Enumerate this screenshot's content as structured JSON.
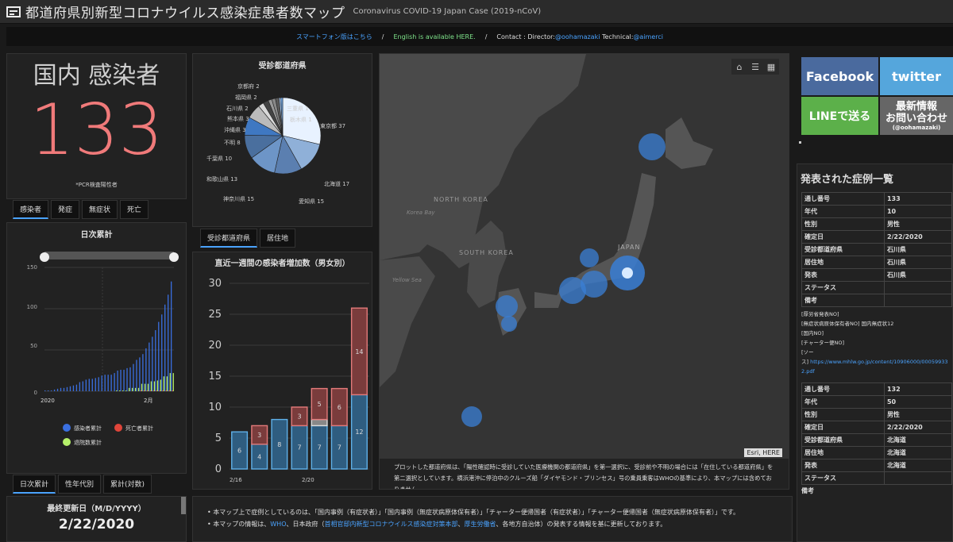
{
  "header": {
    "title": "都道府県別新型コロナウイルス感染症患者数マップ",
    "subtitle": "Coronavirus COVID-19 Japan Case (2019-nCoV)"
  },
  "infobar": {
    "smartphone": "スマートフォン版はこちら",
    "sep1": "/",
    "english": "English is available HERE.",
    "sep2": "/",
    "contact_prefix": "Contact : Director:",
    "director": "@oohamazaki",
    "technical_prefix": " Technical:",
    "technical": "@aimerci"
  },
  "summary": {
    "label": "国内 感染者",
    "count": "133",
    "footnote": "*PCR検査陽性者",
    "tabs": [
      "感染者",
      "発症",
      "無症状",
      "死亡"
    ]
  },
  "daily": {
    "title": "日次累計",
    "y_ticks": [
      "150",
      "100",
      "50",
      "0"
    ],
    "x_ticks": [
      "2020",
      "2月"
    ],
    "legend": [
      {
        "label": "感染者累計",
        "color": "#3a6fe0"
      },
      {
        "label": "死亡者累計",
        "color": "#e0453a"
      },
      {
        "label": "退院数累計",
        "color": "#b5f06a"
      }
    ],
    "tabs": [
      "日次累計",
      "性年代別",
      "累計(対数)"
    ]
  },
  "pie": {
    "title": "受診都道府県",
    "tabs": [
      "受診都道府県",
      "居住地"
    ]
  },
  "weekly": {
    "title": "直近一週間の感染者増加数（男女別）",
    "y_ticks": [
      "30",
      "25",
      "20",
      "15",
      "10",
      "5",
      "0"
    ],
    "x_ticks": [
      "2/16",
      "2/20"
    ]
  },
  "map": {
    "labels": {
      "north_korea": "NORTH KOREA",
      "south_korea": "SOUTH KOREA",
      "korea_bay": "Korea Bay",
      "yellow_sea": "Yellow Sea",
      "japan": "JAPAN"
    },
    "attribution": "Esri, HERE",
    "caption": "プロットした都道府県は、「陽性確認時に受診していた医療機関の都道府県」を第一選択に、受診前や不明の場合には「在住している都道府県」を第二選択としています。横浜港沖に停泊中のクルーズ船「ダイヤモンド・プリンセス」号の乗員乗客はWHOの基準により、本マップには含めておりません。"
  },
  "social": {
    "facebook": "Facebook",
    "twitter": "twitter",
    "line": "LINEで送る",
    "news_line1": "最新情報",
    "news_line2": "お問い合わせ",
    "news_handle": "(@oohamazaki)"
  },
  "cases": {
    "title": "発表された症例一覧",
    "case1": [
      [
        "通し番号",
        "133"
      ],
      [
        "年代",
        "10"
      ],
      [
        "性別",
        "男性"
      ],
      [
        "確定日",
        "2/22/2020"
      ],
      [
        "受診都道府県",
        "石川県"
      ],
      [
        "居住地",
        "石川県"
      ],
      [
        "発表",
        "石川県"
      ],
      [
        "ステータス",
        ""
      ],
      [
        "備考",
        ""
      ]
    ],
    "case1_notes": [
      "[厚労省発表NO]",
      "[無症状病原体保有者NO] 国内無症状12",
      "[国内NO]",
      "[チャーター便NO]",
      "[ソー"
    ],
    "case1_source_prefix": "ス]",
    "case1_source_url": "https://www.mhlw.go.jp/content/10906000/00059933",
    "case1_source_url2": "2.pdf",
    "case2": [
      [
        "通し番号",
        "132"
      ],
      [
        "年代",
        "50"
      ],
      [
        "性別",
        "男性"
      ],
      [
        "確定日",
        "2/22/2020"
      ],
      [
        "受診都道府県",
        "北海道"
      ],
      [
        "居住地",
        "北海道"
      ],
      [
        "発表",
        "北海道"
      ],
      [
        "ステータス",
        ""
      ]
    ],
    "case2_more": "備考"
  },
  "updated": {
    "label": "最終更新日（M/D/YYYY）",
    "date": "2/22/2020"
  },
  "footer_notes": {
    "line1": "本マップ上で症例としているのは、「国内事例（有症状者）」「国内事例（無症状病原体保有者）」「チャーター便帰国者（有症状者）」「チャーター便帰国者（無症状病原体保有者）」です。",
    "line2_a": "本マップの情報は、",
    "line2_who": "WHO",
    "line2_b": "、日本政府（",
    "line2_gov": "首相官邸内新型コロナウイルス感染症対策本部",
    "line2_c": "、",
    "line2_mhlw": "厚生労働省",
    "line2_d": "、各地方自治体）の発表する情報を基に更新しております。"
  },
  "chart_data": [
    {
      "type": "bar",
      "title": "日次累計",
      "ylim": [
        0,
        150
      ],
      "series": [
        {
          "name": "感染者累計",
          "values": [
            1,
            1,
            1,
            2,
            3,
            4,
            4,
            5,
            6,
            7,
            8,
            11,
            12,
            14,
            15,
            15,
            16,
            17,
            19,
            20,
            20,
            20,
            22,
            25,
            26,
            26,
            28,
            29,
            33,
            38,
            41,
            45,
            52,
            59,
            66,
            74,
            84,
            93,
            105,
            117,
            133
          ]
        },
        {
          "name": "死亡者累計",
          "values": [
            0,
            0,
            0,
            0,
            0,
            0,
            0,
            0,
            0,
            0,
            0,
            0,
            0,
            0,
            0,
            0,
            0,
            0,
            0,
            0,
            0,
            0,
            0,
            0,
            0,
            0,
            0,
            0,
            0,
            0,
            1,
            1,
            1,
            1,
            1,
            1,
            1,
            1,
            1,
            1,
            1
          ]
        },
        {
          "name": "退院数累計",
          "values": [
            0,
            0,
            0,
            0,
            0,
            0,
            0,
            0,
            0,
            0,
            0,
            0,
            0,
            0,
            0,
            0,
            0,
            0,
            0,
            0,
            0,
            0,
            1,
            1,
            1,
            1,
            4,
            4,
            4,
            4,
            9,
            9,
            9,
            12,
            12,
            13,
            14,
            18,
            18,
            22,
            22
          ]
        }
      ]
    },
    {
      "type": "pie",
      "title": "受診都道府県",
      "categories": [
        "東京都",
        "北海道",
        "愛知県",
        "神奈川県",
        "和歌山県",
        "千葉県",
        "不明",
        "沖縄県",
        "熊本県",
        "石川県",
        "福岡県",
        "京都府",
        "三重県",
        "栃木県"
      ],
      "values": [
        37,
        17,
        15,
        15,
        13,
        10,
        8,
        3,
        3,
        2,
        2,
        2,
        1,
        1
      ],
      "labels": [
        "東京都 37",
        "北海道 17",
        "愛知県 15",
        "神奈川県 15",
        "和歌山県 13",
        "千葉県 10",
        "不明 8",
        "沖縄県 3",
        "熊本県 3",
        "石川県 2",
        "福岡県 2",
        "京都府 2",
        "三重県 1",
        "栃木県 1"
      ]
    },
    {
      "type": "bar",
      "title": "直近一週間の感染者増加数（男女別）",
      "ylim": [
        0,
        30
      ],
      "categories": [
        "2/16",
        "2/17",
        "2/18",
        "2/19",
        "2/20",
        "2/21",
        "2/22"
      ],
      "series": [
        {
          "name": "男性",
          "values": [
            6,
            4,
            8,
            7,
            7,
            7,
            12
          ]
        },
        {
          "name": "女性",
          "values": [
            0,
            3,
            0,
            3,
            5,
            6,
            14
          ]
        },
        {
          "name": "不明",
          "values": [
            0,
            0,
            0,
            0,
            1,
            0,
            0
          ]
        }
      ]
    }
  ]
}
